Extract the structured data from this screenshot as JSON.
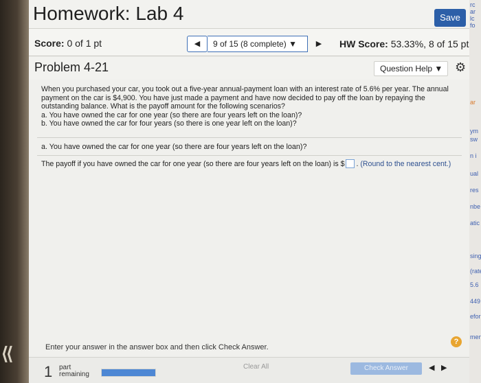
{
  "header": {
    "title": "Homework: Lab 4",
    "save_label": "Save"
  },
  "scorebar": {
    "score_label": "Score:",
    "score_value": "0 of 1 pt",
    "nav_prev_icon": "left-triangle-icon",
    "question_selector": "9 of 15 (8 complete)",
    "nav_next_icon": "right-triangle-icon",
    "hw_score_label": "HW Score:",
    "hw_score_value": "53.33%, 8 of 15 pts"
  },
  "problem": {
    "title": "Problem 4-21",
    "question_help_label": "Question Help",
    "settings_icon": "gear-icon"
  },
  "question": {
    "stem": "When you purchased your car, you took out a five-year annual-payment loan with an interest rate of 5.6% per year. The annual payment on the car is $4,900. You have just made a payment and have now decided to pay off the loan by repaying the outstanding balance. What is the payoff amount for the following scenarios?",
    "scenario_a": "a. You have owned the car for one year (so there are four years left on the loan)?",
    "scenario_b": "b. You have owned the car for four years (so there is one year left on the loan)?",
    "part_a_heading": "a. You have owned the car for one year (so there are four years left on the loan)?",
    "answer_prefix": "The payoff if you have owned the car for one year (so there are four years left on the loan) is $",
    "answer_value": "",
    "answer_suffix": ".",
    "round_note": "(Round to the nearest cent.)"
  },
  "instructions": "Enter your answer in the answer box and then click Check Answer.",
  "footer": {
    "parts_count": "1",
    "parts_label_line1": "part",
    "parts_label_line2": "remaining",
    "progress": 1.0,
    "clear_all_label": "Clear All",
    "check_answer_label": "Check Answer"
  },
  "side_strip": [
    "rc",
    "ar",
    "lc",
    "fo",
    "ar",
    "ym",
    "sw",
    "n i",
    "ual",
    "res",
    "nbe",
    "atic",
    "sing",
    "(rate",
    "5.6",
    "449",
    "efor",
    "ment"
  ],
  "colors": {
    "accent": "#2c5fa8",
    "progress_fill": "#4d87d4",
    "help_icon": "#e8a531"
  }
}
